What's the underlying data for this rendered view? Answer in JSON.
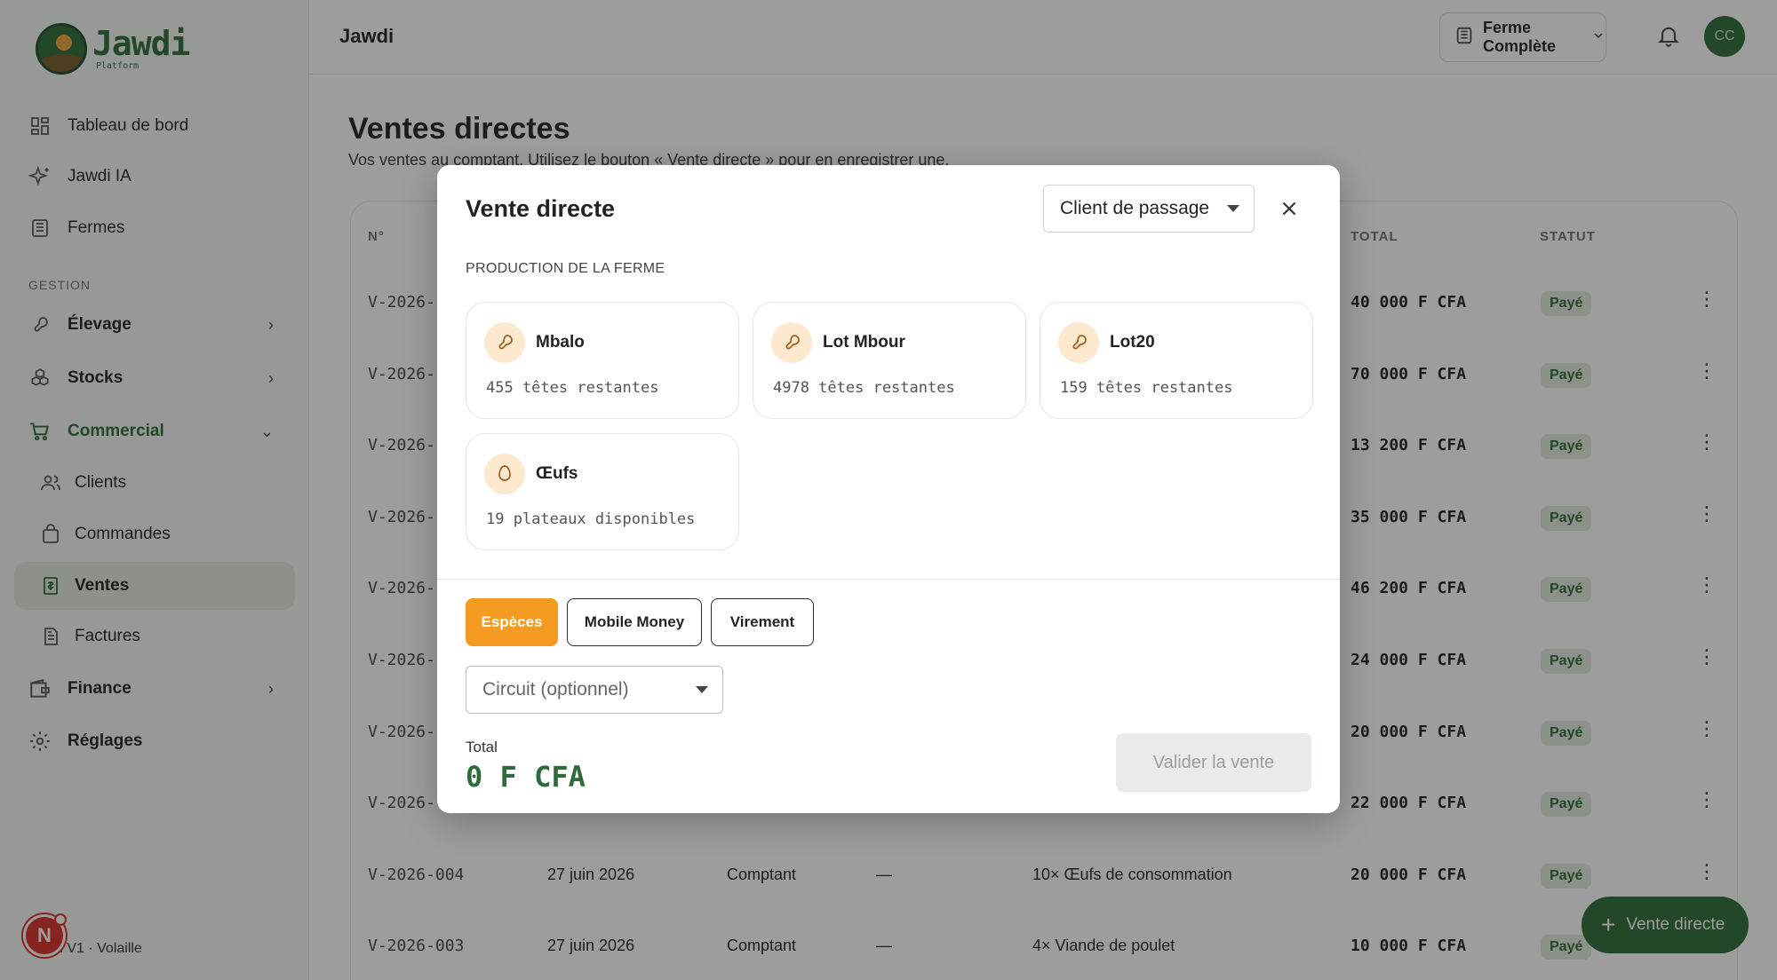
{
  "app": {
    "logo_title": "Jawdi",
    "logo_sub": "Platform",
    "footer_version": "Jawdi V1 · Volaille",
    "notif_avatar": "N"
  },
  "sidebar": {
    "items": [
      {
        "label": "Tableau de bord",
        "icon": "dashboard-icon"
      },
      {
        "label": "Jawdi IA",
        "icon": "sparkle-icon"
      },
      {
        "label": "Fermes",
        "icon": "building-icon"
      }
    ],
    "section_label": "GESTION",
    "groups": [
      {
        "label": "Élevage",
        "icon": "drumstick-icon"
      },
      {
        "label": "Stocks",
        "icon": "boxes-icon"
      },
      {
        "label": "Commercial",
        "icon": "cart-icon"
      },
      {
        "label": "Finance",
        "icon": "wallet-icon"
      },
      {
        "label": "Réglages",
        "icon": "gear-icon"
      }
    ],
    "sub_items": [
      {
        "label": "Clients",
        "icon": "users-icon"
      },
      {
        "label": "Commandes",
        "icon": "bag-icon"
      },
      {
        "label": "Ventes",
        "icon": "receipt-icon"
      },
      {
        "label": "Factures",
        "icon": "document-icon"
      }
    ]
  },
  "topbar": {
    "title": "Jawdi",
    "farm_select": "Ferme Complète",
    "user_initials": "CC"
  },
  "page": {
    "title": "Ventes directes",
    "subtitle": "Vos ventes au comptant. Utilisez le bouton « Vente directe » pour en enregistrer une.",
    "fab_label": "Vente directe"
  },
  "table": {
    "headers": {
      "num": "N°",
      "total": "TOTAL",
      "status": "STATUT"
    },
    "rows": [
      {
        "num": "V-2026-",
        "date": "",
        "type": "",
        "client": "",
        "items": "",
        "total": "40 000 F CFA",
        "status": "Payé"
      },
      {
        "num": "V-2026-",
        "date": "",
        "type": "",
        "client": "",
        "items": "",
        "total": "70 000 F CFA",
        "status": "Payé"
      },
      {
        "num": "V-2026-",
        "date": "",
        "type": "",
        "client": "",
        "items": "",
        "total": "13 200 F CFA",
        "status": "Payé"
      },
      {
        "num": "V-2026-",
        "date": "",
        "type": "",
        "client": "",
        "items": "",
        "total": "35 000 F CFA",
        "status": "Payé"
      },
      {
        "num": "V-2026-",
        "date": "",
        "type": "",
        "client": "",
        "items": "",
        "total": "46 200 F CFA",
        "status": "Payé"
      },
      {
        "num": "V-2026-",
        "date": "",
        "type": "",
        "client": "",
        "items": "",
        "total": "24 000 F CFA",
        "status": "Payé"
      },
      {
        "num": "V-2026-",
        "date": "",
        "type": "",
        "client": "",
        "items": "",
        "total": "20 000 F CFA",
        "status": "Payé"
      },
      {
        "num": "V-2026-",
        "date": "",
        "type": "",
        "client": "",
        "items": "",
        "total": "22 000 F CFA",
        "status": "Payé"
      },
      {
        "num": "V-2026-004",
        "date": "27 juin 2026",
        "type": "Comptant",
        "client": "—",
        "items": "10× Œufs de consommation",
        "total": "20 000 F CFA",
        "status": "Payé"
      },
      {
        "num": "V-2026-003",
        "date": "27 juin 2026",
        "type": "Comptant",
        "client": "—",
        "items": "4× Viande de poulet",
        "total": "10 000 F CFA",
        "status": "Payé"
      }
    ]
  },
  "modal": {
    "title": "Vente directe",
    "client_select": "Client de passage",
    "section_caption": "PRODUCTION DE LA FERME",
    "products": [
      {
        "name": "Mbalo",
        "stock": "455 têtes restantes",
        "icon": "drumstick-icon"
      },
      {
        "name": "Lot Mbour",
        "stock": "4978 têtes restantes",
        "icon": "drumstick-icon"
      },
      {
        "name": "Lot20",
        "stock": "159 têtes restantes",
        "icon": "drumstick-icon"
      },
      {
        "name": "Œufs",
        "stock": "19 plateaux disponibles",
        "icon": "egg-icon"
      }
    ],
    "payment_methods": [
      "Espèces",
      "Mobile Money",
      "Virement"
    ],
    "selected_payment": "Espèces",
    "circuit_placeholder": "Circuit (optionnel)",
    "total_label": "Total",
    "total_value": "0 F CFA",
    "validate_label": "Valider la vente"
  },
  "colors": {
    "brand_green": "#2f6b3a",
    "accent_orange": "#f59b22",
    "badge_bg": "#e3ebdf"
  }
}
